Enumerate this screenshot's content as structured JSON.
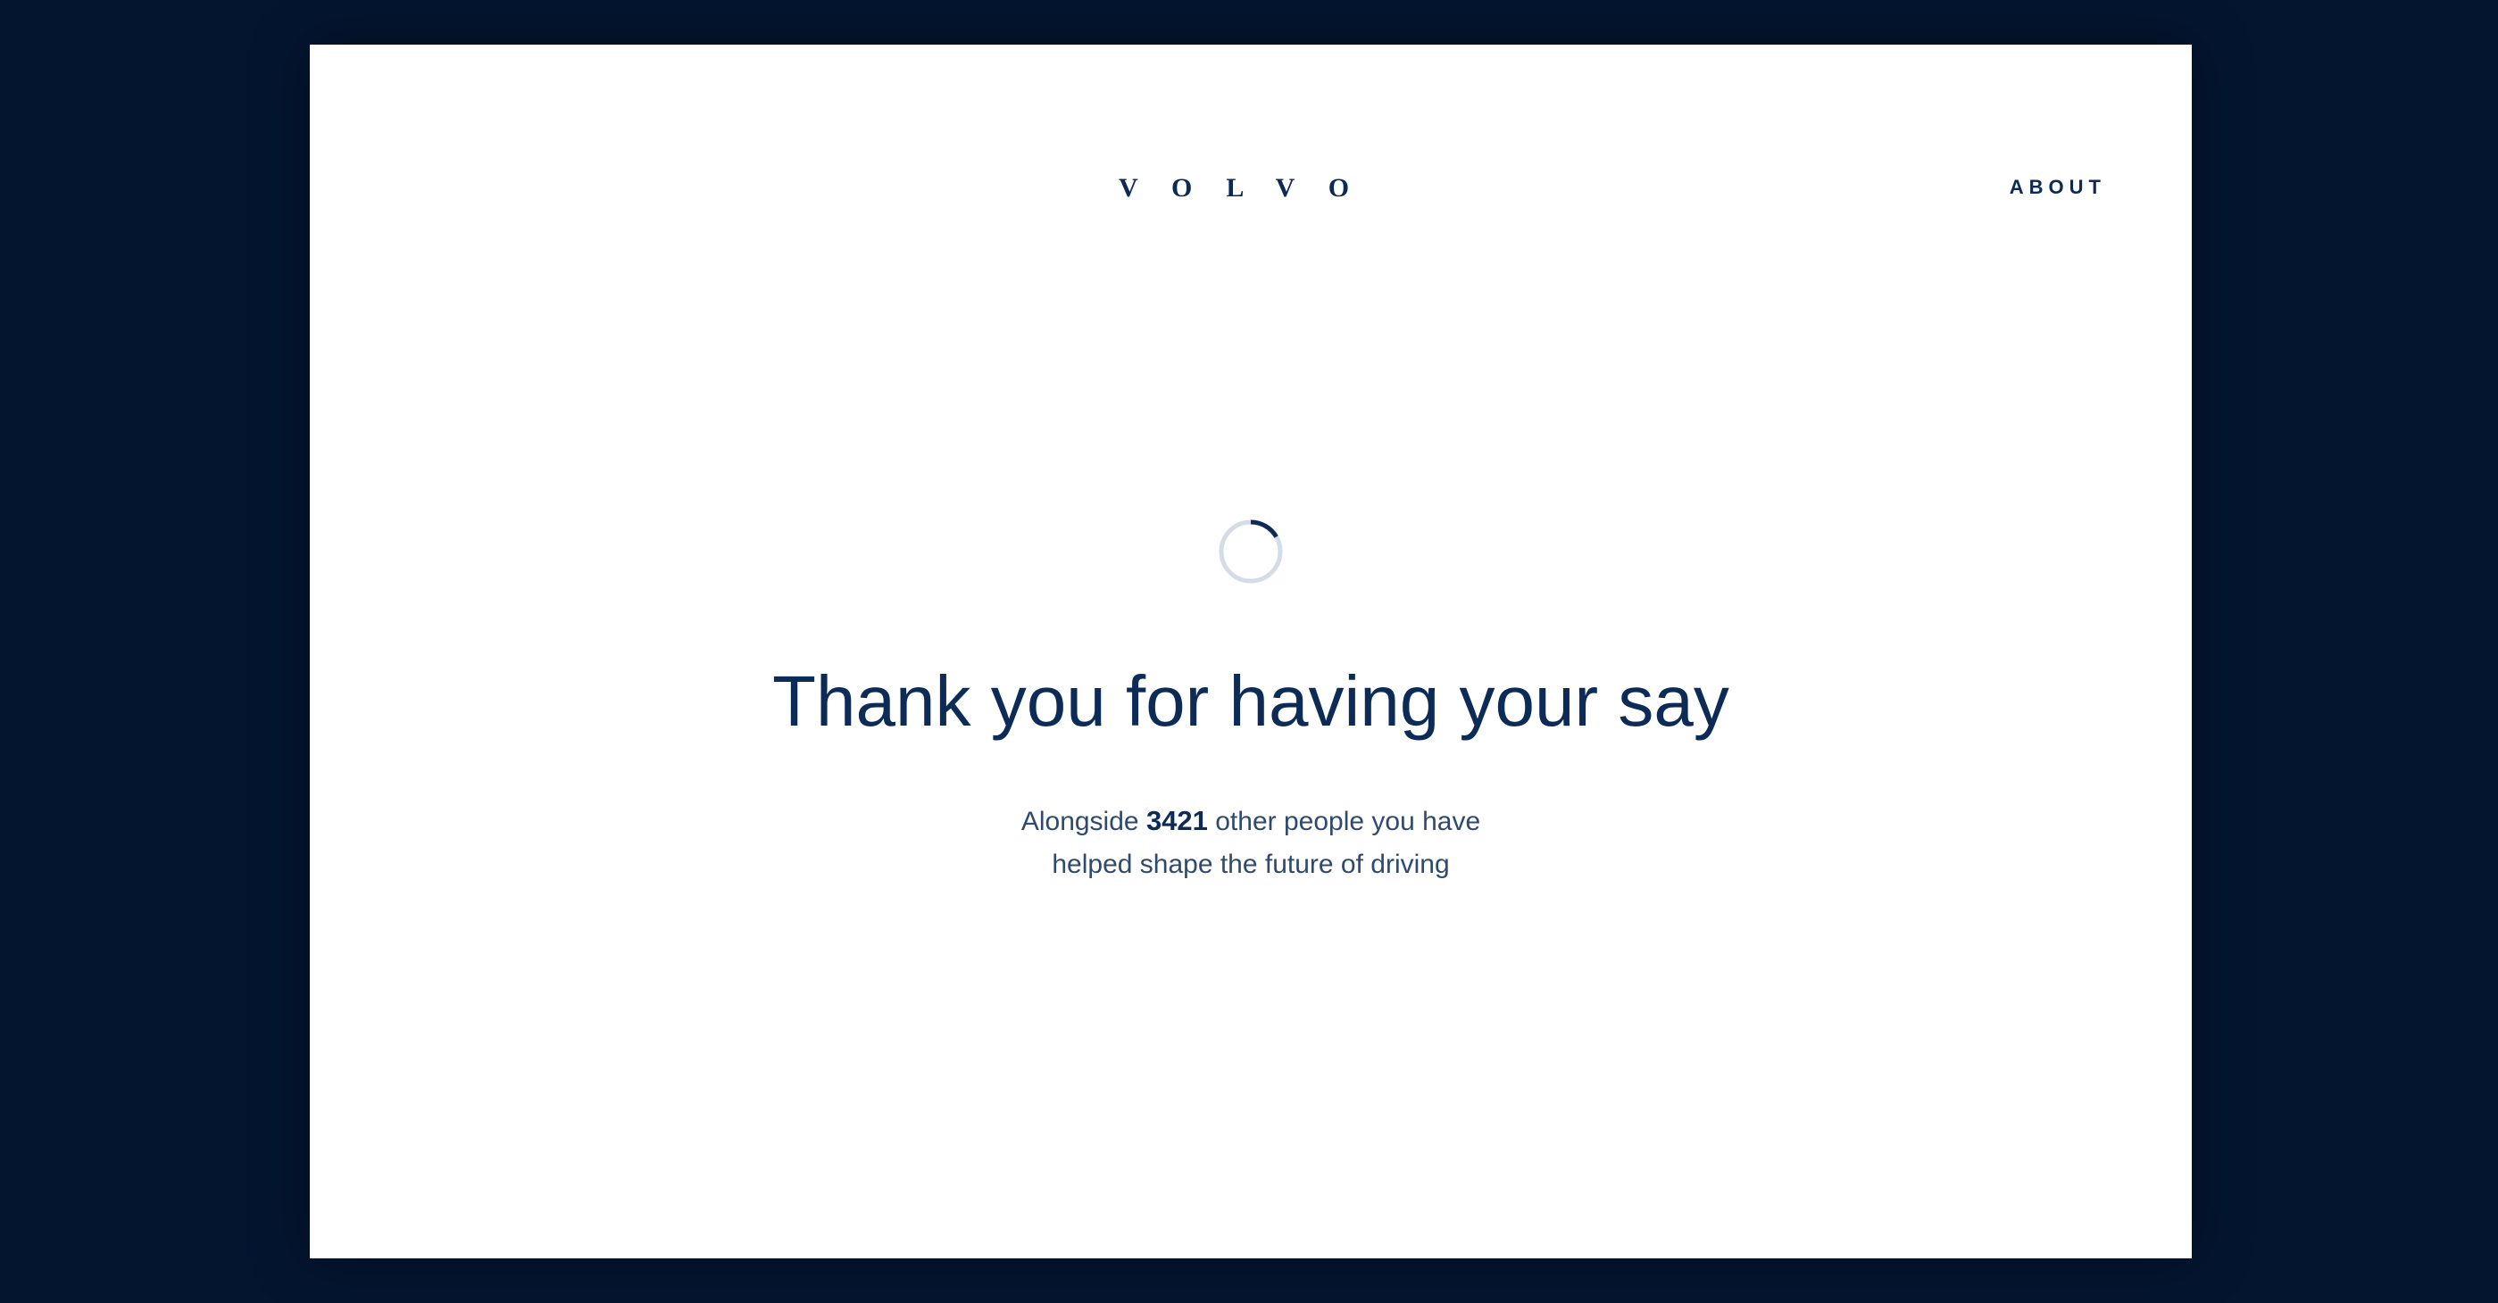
{
  "header": {
    "logo_text": "VOLVO",
    "about_label": "ABOUT"
  },
  "main": {
    "spinner": {
      "icon": "loading-spinner-icon",
      "track_color": "#d3dce7",
      "arc_color": "#0d2b57"
    },
    "headline": "Thank you for having your say",
    "message": {
      "prefix": "Alongside",
      "count": "3421",
      "suffix_line1": "other people you have",
      "line2": "helped shape the future of driving"
    }
  },
  "colors": {
    "background": "#041530",
    "card": "#ffffff",
    "brand_navy": "#0d2b57",
    "body_text": "#2f4a6e"
  }
}
